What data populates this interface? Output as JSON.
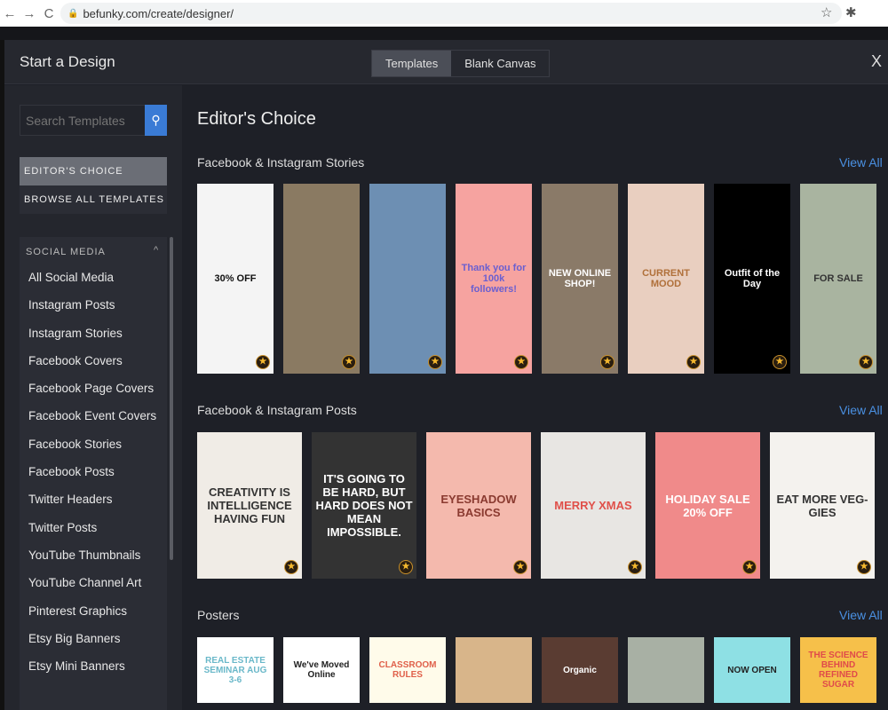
{
  "browser": {
    "url": "befunky.com/create/designer/",
    "back": "←",
    "forward": "→",
    "reload": "C"
  },
  "modal": {
    "title": "Start a Design",
    "tabs": [
      "Templates",
      "Blank Canvas"
    ],
    "close": "X"
  },
  "sidebar": {
    "search_placeholder": "Search Templates",
    "tabs": [
      "EDITOR'S CHOICE",
      "BROWSE ALL TEMPLATES"
    ],
    "category_header": "SOCIAL MEDIA",
    "items": [
      "All Social Media",
      "Instagram Posts",
      "Instagram Stories",
      "Facebook Covers",
      "Facebook Page Covers",
      "Facebook Event Covers",
      "Facebook Stories",
      "Facebook Posts",
      "Twitter Headers",
      "Twitter Posts",
      "YouTube Thumbnails",
      "YouTube Channel Art",
      "Pinterest Graphics",
      "Etsy Big Banners",
      "Etsy Mini Banners"
    ]
  },
  "main": {
    "title": "Editor's Choice",
    "view_all": "View All",
    "sections": [
      {
        "title": "Facebook & Instagram Stories",
        "cards": [
          {
            "text": "30% OFF",
            "bg": "#f4f4f4",
            "fg": "#111"
          },
          {
            "text": "",
            "bg": "#8a7a62",
            "fg": "#fff"
          },
          {
            "text": "",
            "bg": "#6d8fb3",
            "fg": "#fff"
          },
          {
            "text": "Thank you for 100k followers!",
            "bg": "#f6a3a0",
            "fg": "#6a5fd0"
          },
          {
            "text": "NEW ONLINE SHOP!",
            "bg": "#8a7a68",
            "fg": "#fff"
          },
          {
            "text": "CURRENT MOOD",
            "bg": "#e9cfc0",
            "fg": "#b0703a"
          },
          {
            "text": "Outfit of the Day",
            "bg": "#000000",
            "fg": "#fff"
          },
          {
            "text": "FOR SALE",
            "bg": "#a9b4a0",
            "fg": "#333"
          }
        ]
      },
      {
        "title": "Facebook & Instagram Posts",
        "cards": [
          {
            "text": "CREATIVITY IS INTELLIGENCE HAVING FUN",
            "bg": "#f0ece6",
            "fg": "#333"
          },
          {
            "text": "IT'S GOING TO BE HARD, BUT HARD DOES NOT MEAN IMPOSSIBLE.",
            "bg": "#333333",
            "fg": "#fff"
          },
          {
            "text": "EYESHADOW BASICS",
            "bg": "#f4b9ad",
            "fg": "#8a3a30"
          },
          {
            "text": "MERRY XMAS",
            "bg": "#e8e6e3",
            "fg": "#e0504a"
          },
          {
            "text": "HOLIDAY SALE 20% OFF",
            "bg": "#f08a8a",
            "fg": "#fff"
          },
          {
            "text": "EAT MORE VEG-GIES",
            "bg": "#f4f2ee",
            "fg": "#333"
          }
        ]
      },
      {
        "title": "Posters",
        "cards": [
          {
            "text": "REAL ESTATE SEMINAR AUG 3-6",
            "bg": "#ffffff",
            "fg": "#6ab8c9"
          },
          {
            "text": "We've Moved Online",
            "bg": "#ffffff",
            "fg": "#222"
          },
          {
            "text": "CLASSROOM RULES",
            "bg": "#fffbea",
            "fg": "#e0604a"
          },
          {
            "text": "",
            "bg": "#d8b58a",
            "fg": "#333"
          },
          {
            "text": "Organic",
            "bg": "#5a3c32",
            "fg": "#fff"
          },
          {
            "text": "",
            "bg": "#a8b0a4",
            "fg": "#333"
          },
          {
            "text": "NOW OPEN",
            "bg": "#8ee0e4",
            "fg": "#222"
          },
          {
            "text": "THE SCIENCE BEHIND REFINED SUGAR",
            "bg": "#f6c04a",
            "fg": "#e04a4a"
          }
        ]
      }
    ]
  }
}
